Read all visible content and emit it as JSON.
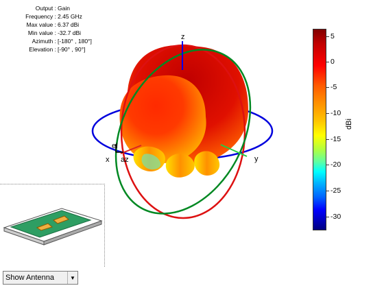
{
  "info": {
    "rows": [
      {
        "label": "Output :",
        "value": "Gain"
      },
      {
        "label": "Frequency :",
        "value": "2.45 GHz"
      },
      {
        "label": "Max value :",
        "value": "6.37 dBi"
      },
      {
        "label": "Min value :",
        "value": "-32.7 dBi"
      },
      {
        "label": "Azimuth :",
        "value": "[-180° , 180°]"
      },
      {
        "label": "Elevation :",
        "value": "[-90° , 90°]"
      }
    ]
  },
  "plot": {
    "axis_labels": {
      "x": "x",
      "y": "y",
      "z": "z",
      "el": "el",
      "az": "az"
    }
  },
  "colorbar": {
    "ticks": [
      "5",
      "0",
      "-5",
      "-10",
      "-15",
      "-20",
      "-25",
      "-30"
    ],
    "unit": "dBi"
  },
  "control": {
    "selected": "Show Antenna",
    "arrow_icon": "chevron-down-icon"
  }
}
